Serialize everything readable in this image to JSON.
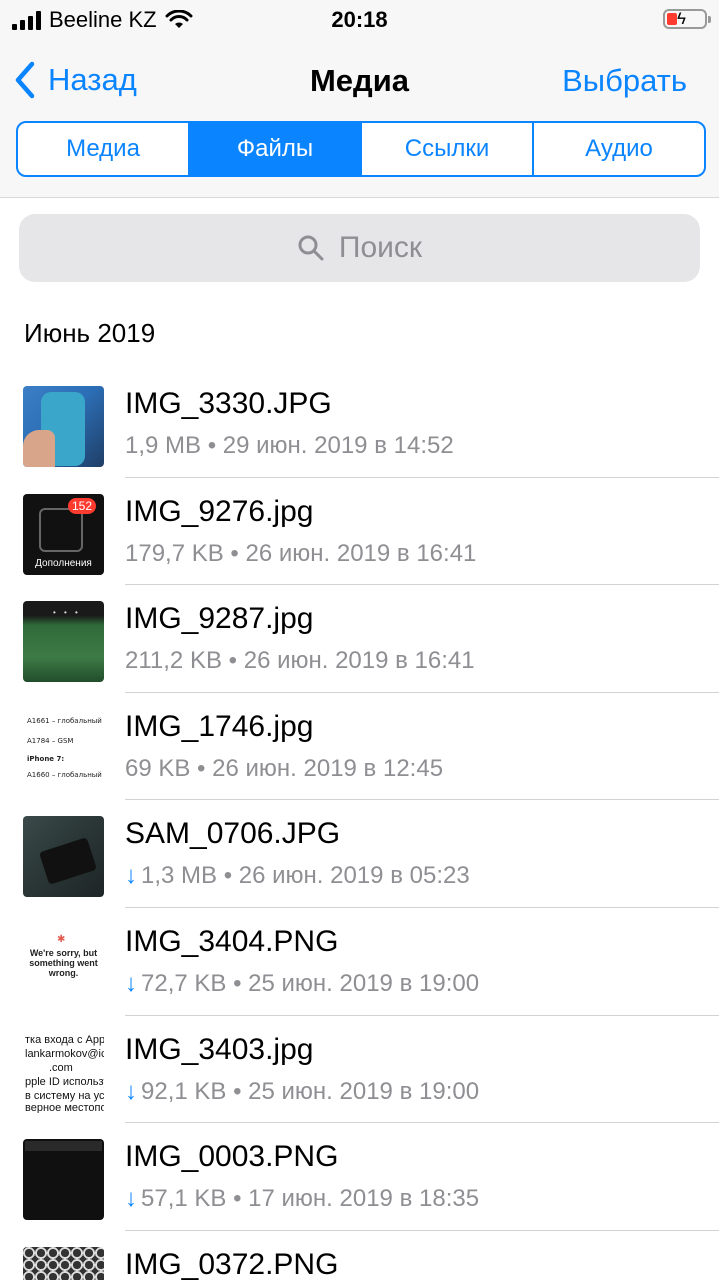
{
  "status_bar": {
    "carrier": "Beeline KZ",
    "time": "20:18"
  },
  "nav": {
    "back_label": "Назад",
    "title": "Медиа",
    "select_label": "Выбрать"
  },
  "tabs": [
    {
      "label": "Медиа",
      "active": false
    },
    {
      "label": "Файлы",
      "active": true
    },
    {
      "label": "Ссылки",
      "active": false
    },
    {
      "label": "Аудио",
      "active": false
    }
  ],
  "search": {
    "placeholder": "Поиск"
  },
  "section": {
    "header": "Июнь 2019"
  },
  "thumbs": {
    "badge_count": "152",
    "extensions_label": "Дополнения",
    "t4_lines": [
      "A1661 – глобальный",
      "A1784 – GSM",
      "iPhone 7:",
      "A1660 – глобальный"
    ],
    "t6_text": [
      "We're sorry, but",
      "something went wrong."
    ],
    "t7_lines": [
      "тка входа с Appl",
      "lankarmokov@ic",
      ".com",
      "pple ID используется",
      "в систему на устрой",
      "верное местополож"
    ]
  },
  "files": [
    {
      "name": "IMG_3330.JPG",
      "size": "1,9 MB",
      "date": "29 июн. 2019 в 14:52",
      "download": false
    },
    {
      "name": "IMG_9276.jpg",
      "size": "179,7 KB",
      "date": "26 июн. 2019 в 16:41",
      "download": false
    },
    {
      "name": "IMG_9287.jpg",
      "size": "211,2 KB",
      "date": "26 июн. 2019 в 16:41",
      "download": false
    },
    {
      "name": "IMG_1746.jpg",
      "size": "69 KB",
      "date": "26 июн. 2019 в 12:45",
      "download": false
    },
    {
      "name": "SAM_0706.JPG",
      "size": "1,3 MB",
      "date": "26 июн. 2019 в 05:23",
      "download": true
    },
    {
      "name": "IMG_3404.PNG",
      "size": "72,7 KB",
      "date": "25 июн. 2019 в 19:00",
      "download": true
    },
    {
      "name": "IMG_3403.jpg",
      "size": "92,1 KB",
      "date": "25 июн. 2019 в 19:00",
      "download": true
    },
    {
      "name": "IMG_0003.PNG",
      "size": "57,1 KB",
      "date": "17 июн. 2019 в 18:35",
      "download": true
    },
    {
      "name": "IMG_0372.PNG",
      "size": "",
      "date": "",
      "download": false
    }
  ]
}
